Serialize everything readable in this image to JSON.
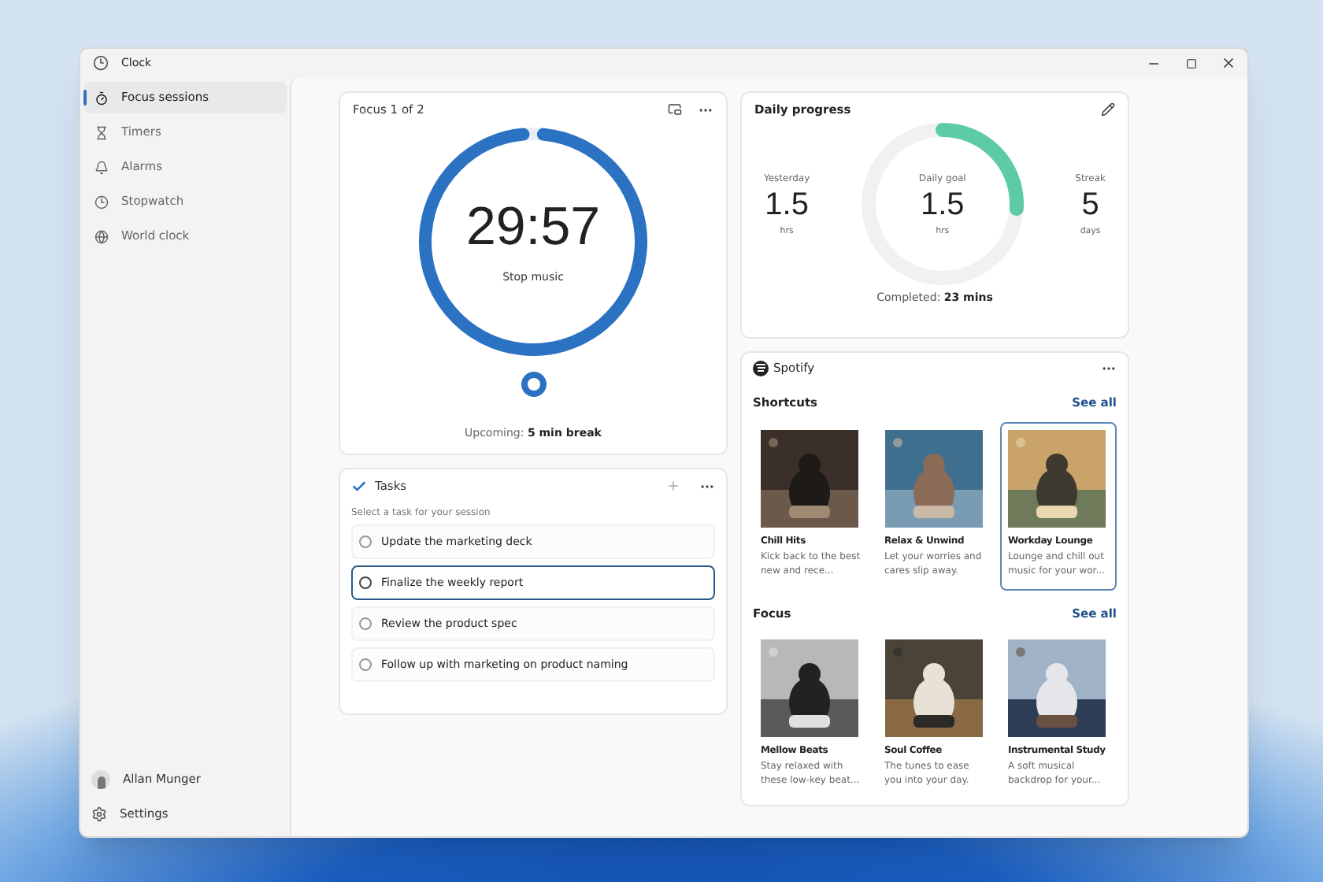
{
  "window": {
    "title": "Clock"
  },
  "sidebar": {
    "items": [
      {
        "label": "Focus sessions",
        "selected": true
      },
      {
        "label": "Timers",
        "selected": false
      },
      {
        "label": "Alarms",
        "selected": false
      },
      {
        "label": "Stopwatch",
        "selected": false
      },
      {
        "label": "World clock",
        "selected": false
      }
    ],
    "user": "Allan Munger",
    "settings": "Settings"
  },
  "focus": {
    "title": "Focus 1 of 2",
    "time": "29:57",
    "music_button": "Stop music",
    "level": 0.97,
    "upcoming_label": "Upcoming:",
    "upcoming_value": "5 min break"
  },
  "tasks": {
    "title": "Tasks",
    "hint": "Select a task for your session",
    "items": [
      {
        "label": "Update the marketing deck",
        "selected": false
      },
      {
        "label": "Finalize the weekly report",
        "selected": true
      },
      {
        "label": "Review the product spec",
        "selected": false
      },
      {
        "label": "Follow up with marketing on product naming",
        "selected": false
      }
    ]
  },
  "daily_progress": {
    "title": "Daily progress",
    "level": 0.26,
    "stats": [
      {
        "label": "Yesterday",
        "value": "1.5",
        "unit": "hrs"
      },
      {
        "label": "Daily goal",
        "value": "1.5",
        "unit": "hrs"
      },
      {
        "label": "Streak",
        "value": "5",
        "unit": "days"
      }
    ],
    "completed_label": "Completed:",
    "completed_value": "23 mins"
  },
  "spotify": {
    "title": "Spotify",
    "sections": [
      {
        "title": "Shortcuts",
        "see_all": "See all",
        "items": [
          {
            "title": "Chill Hits",
            "description": "Kick back to the best new and rece...",
            "selected": false
          },
          {
            "title": "Relax & Unwind",
            "description": "Let your worries and cares slip away.",
            "selected": false
          },
          {
            "title": "Workday Lounge",
            "description": "Lounge and chill out music for your wor...",
            "selected": true
          }
        ]
      },
      {
        "title": "Focus",
        "see_all": "See all",
        "items": [
          {
            "title": "Mellow  Beats",
            "description": "Stay relaxed with these low-key beat...",
            "selected": false
          },
          {
            "title": "Soul Coffee",
            "description": "The tunes to ease you into your day.",
            "selected": false
          },
          {
            "title": "Instrumental Study",
            "description": "A soft musical backdrop for your...",
            "selected": false
          }
        ]
      }
    ]
  }
}
